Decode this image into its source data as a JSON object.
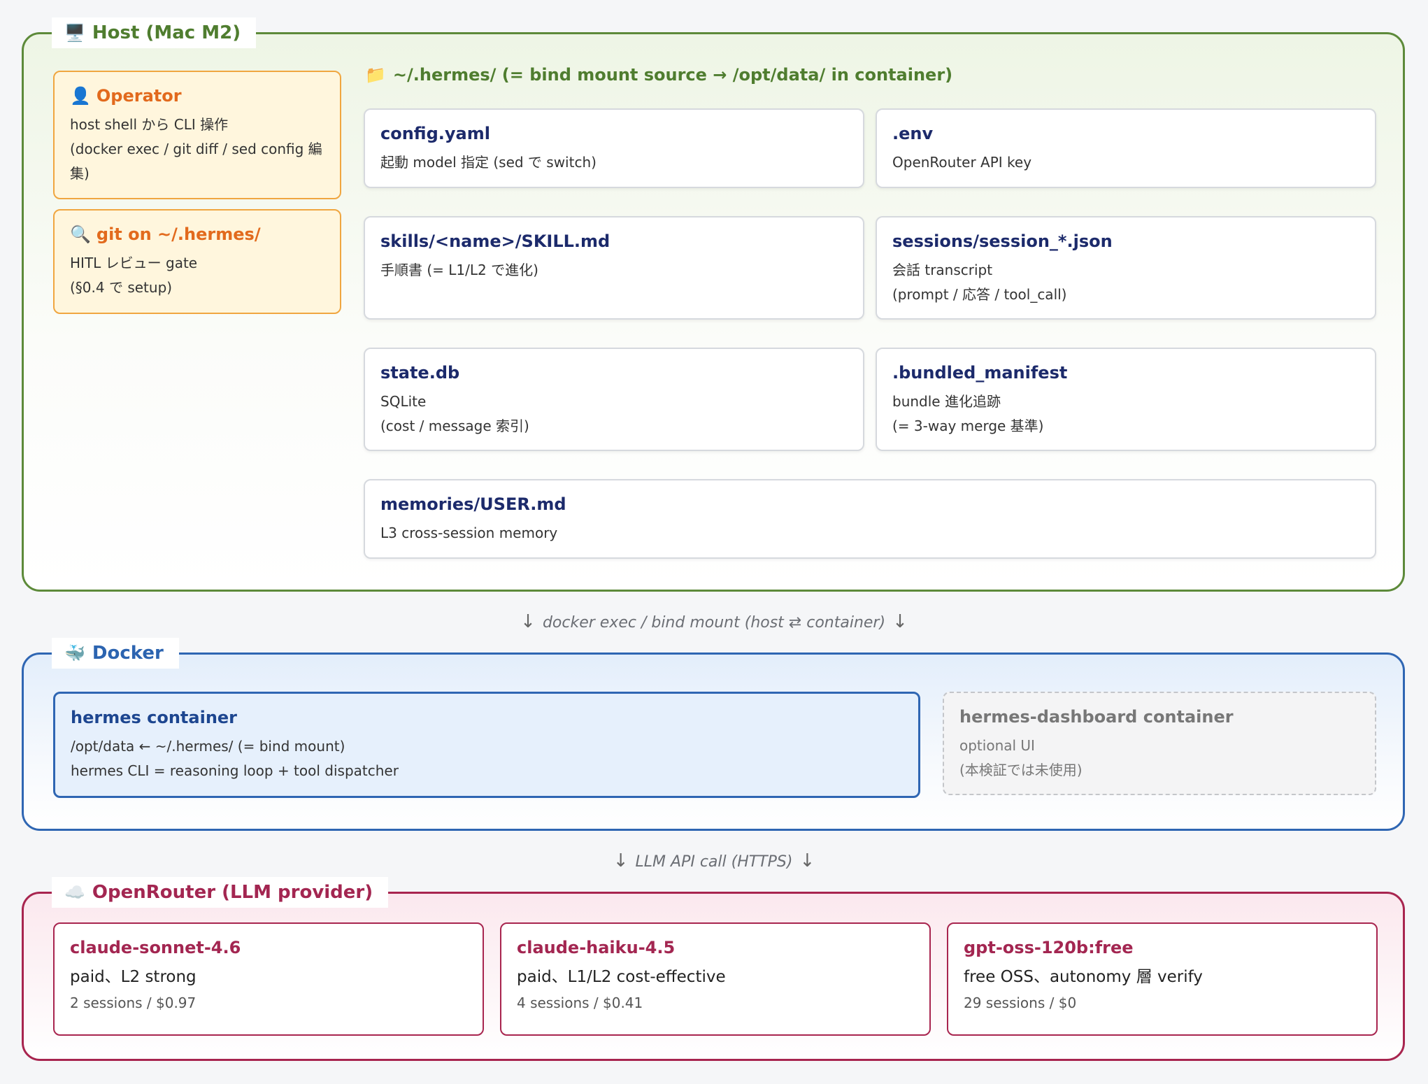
{
  "host": {
    "icon": "🖥️",
    "title": "Host (Mac M2)",
    "operator": {
      "icon": "👤",
      "title": "Operator",
      "lines": [
        "host shell から CLI 操作",
        "(docker exec / git diff / sed config 編",
        "集)"
      ]
    },
    "git": {
      "icon": "🔍",
      "title": "git on ~/.hermes/",
      "lines": [
        "HITL レビュー gate",
        "(§0.4 で setup)"
      ]
    },
    "files_header": {
      "icon": "📁",
      "text": "~/.hermes/ (= bind mount source → /opt/data/ in container)"
    },
    "files": [
      {
        "title": "config.yaml",
        "lines": [
          "起動 model 指定 (sed で switch)"
        ]
      },
      {
        "title": ".env",
        "lines": [
          "OpenRouter API key"
        ]
      },
      {
        "title": "skills/<name>/SKILL.md",
        "lines": [
          "手順書 (= L1/L2 で進化)"
        ]
      },
      {
        "title": "sessions/session_*.json",
        "lines": [
          "会話 transcript",
          "(prompt / 応答 / tool_call)"
        ]
      },
      {
        "title": "state.db",
        "lines": [
          "SQLite",
          "(cost / message 索引)"
        ]
      },
      {
        "title": ".bundled_manifest",
        "lines": [
          "bundle 進化追跡",
          "(= 3-way merge 基準)"
        ]
      },
      {
        "title": "memories/USER.md",
        "lines": [
          "L3 cross-session memory"
        ]
      }
    ]
  },
  "connector_host_docker": {
    "arrow_left": "↓",
    "text": "docker exec / bind mount (host ⇄ container)",
    "arrow_right": "↓"
  },
  "docker": {
    "icon": "🐳",
    "title": "Docker",
    "hermes": {
      "title": "hermes container",
      "lines": [
        "/opt/data ← ~/.hermes/ (= bind mount)",
        "hermes CLI = reasoning loop + tool dispatcher"
      ]
    },
    "dashboard": {
      "title": "hermes-dashboard container",
      "lines": [
        "optional UI",
        "(本検証では未使用)"
      ]
    }
  },
  "connector_docker_openrouter": {
    "arrow_left": "↓",
    "text": "LLM API call (HTTPS)",
    "arrow_right": "↓"
  },
  "openrouter": {
    "icon": "☁️",
    "title": "OpenRouter (LLM provider)",
    "models": [
      {
        "name": "claude-sonnet-4.6",
        "desc": "paid、L2 strong",
        "stats": "2 sessions / $0.97"
      },
      {
        "name": "claude-haiku-4.5",
        "desc": "paid、L1/L2 cost-effective",
        "stats": "4 sessions / $0.41"
      },
      {
        "name": "gpt-oss-120b:free",
        "desc": "free OSS、autonomy 層 verify",
        "stats": "29 sessions / $0"
      }
    ]
  }
}
